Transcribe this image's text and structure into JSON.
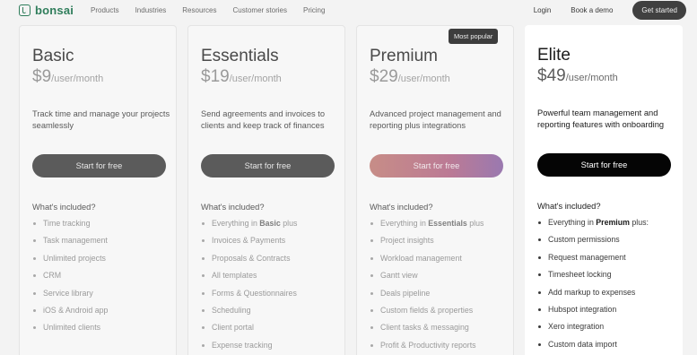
{
  "nav": {
    "logo": "bonsai",
    "links": [
      "Products",
      "Industries",
      "Resources",
      "Customer stories",
      "Pricing"
    ],
    "login": "Login",
    "demo": "Book a demo",
    "cta": "Get started"
  },
  "badge": "Most popular",
  "included_label": "What's included?",
  "plans": [
    {
      "name": "Basic",
      "price": "$9",
      "per": "/user/month",
      "desc": "Track time and manage your projects seamlessly",
      "cta": "Start for free",
      "features": [
        "Time tracking",
        "Task management",
        "Unlimited projects",
        "CRM",
        "Service library",
        "iOS & Android app",
        "Unlimited clients"
      ]
    },
    {
      "name": "Essentials",
      "price": "$19",
      "per": "/user/month",
      "desc": "Send agreements and invoices to clients and keep track of finances",
      "cta": "Start for free",
      "lead_pre": "Everything in ",
      "lead_bold": "Basic",
      "lead_post": " plus",
      "features": [
        "Invoices & Payments",
        "Proposals & Contracts",
        "All templates",
        "Forms & Questionnaires",
        "Scheduling",
        "Client portal",
        "Expense tracking"
      ]
    },
    {
      "name": "Premium",
      "price": "$29",
      "per": "/user/month",
      "desc": "Advanced project management and reporting plus integrations",
      "cta": "Start for free",
      "lead_pre": "Everything in ",
      "lead_bold": "Essentials",
      "lead_post": " plus",
      "features": [
        "Project insights",
        "Workload management",
        "Gantt view",
        "Deals pipeline",
        "Custom fields & properties",
        "Client tasks & messaging",
        "Profit & Productivity reports"
      ]
    },
    {
      "name": "Elite",
      "price": "$49",
      "per": "/user/month",
      "desc": "Powerful team management and reporting features with onboarding",
      "cta": "Start for free",
      "lead_pre": "Everything in ",
      "lead_bold": "Premium",
      "lead_post": " plus:",
      "features": [
        "Custom permissions",
        "Request management",
        "Timesheet locking",
        "Add markup to expenses",
        "Hubspot integration",
        "Xero integration",
        "Custom data import"
      ]
    }
  ]
}
